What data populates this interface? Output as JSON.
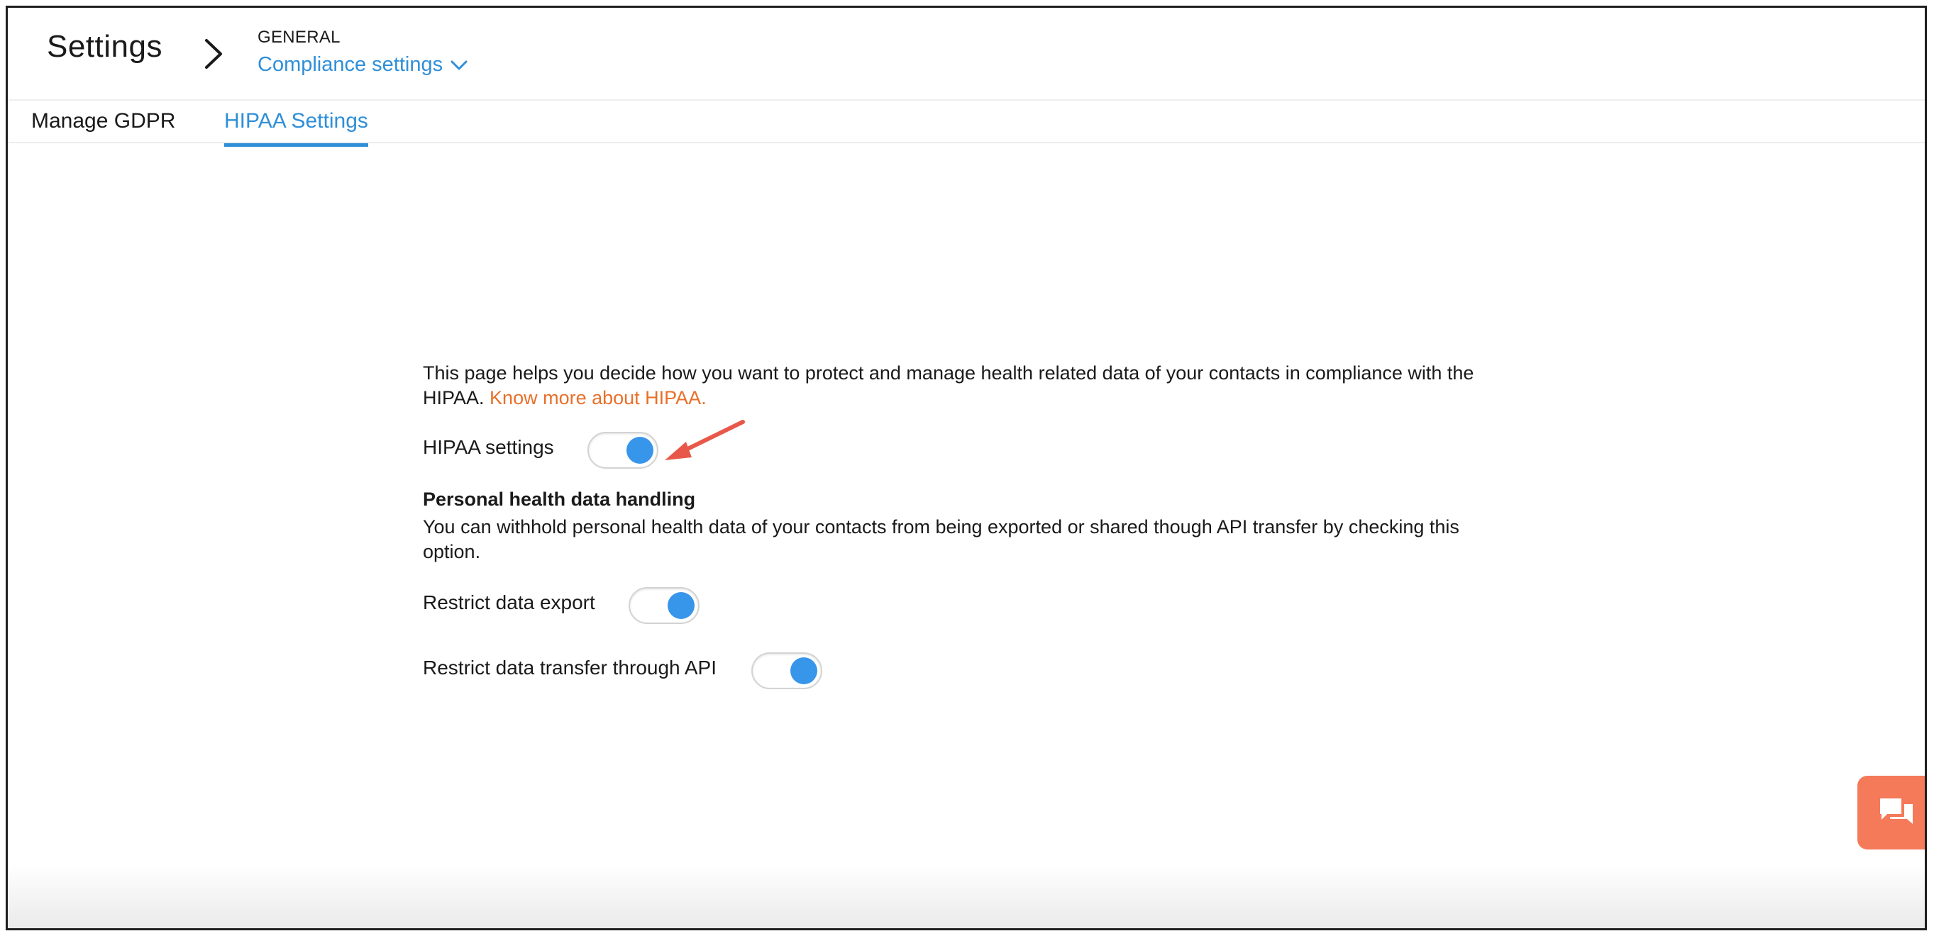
{
  "header": {
    "title": "Settings",
    "breadcrumb_section": "GENERAL",
    "breadcrumb_page": "Compliance settings"
  },
  "tabs": [
    {
      "label": "Manage GDPR",
      "active": false
    },
    {
      "label": "HIPAA Settings",
      "active": true
    }
  ],
  "content": {
    "intro_text": "This page helps you decide how you want to protect and manage health related data of your contacts in compliance with the HIPAA.",
    "intro_link": "Know more about HIPAA.",
    "hipaa_toggle": {
      "label": "HIPAA settings",
      "on": true
    },
    "section_heading": "Personal health data handling",
    "section_desc": "You can withhold personal health data of your contacts from being exported or shared though API transfer by checking this option.",
    "export_toggle": {
      "label": "Restrict data export",
      "on": true
    },
    "api_toggle": {
      "label": "Restrict data transfer through API",
      "on": true
    }
  },
  "colors": {
    "accent": "#2f8fd8",
    "toggle_knob": "#3795ea",
    "link": "#e8702a",
    "annotation_arrow": "#e8584a",
    "chat_button": "#f47a5a"
  },
  "icons": {
    "breadcrumb_separator": "chevron-right-icon",
    "dropdown": "chevron-down-icon",
    "chat": "chat-bubbles-icon"
  }
}
